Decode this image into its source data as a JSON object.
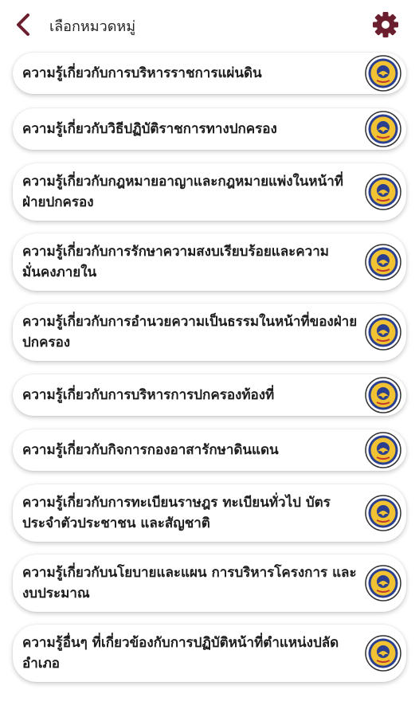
{
  "header": {
    "title": "เลือกหมวดหมู่",
    "back_icon": "chevron-left-icon",
    "settings_icon": "gear-icon",
    "accent_color": "#6b1f2e"
  },
  "categories": [
    {
      "label": "ความรู้เกี่ยวกับการบริหารราชการแผ่นดิน",
      "icon": "dopa-emblem-icon"
    },
    {
      "label": "ความรู้เกี่ยวกับวิธีปฏิบัติราชการทางปกครอง",
      "icon": "dopa-emblem-icon"
    },
    {
      "label": "ความรู้เกี่ยวกับกฎหมายอาญาและกฎหมายแพ่งในหน้าที่ฝ่ายปกครอง",
      "icon": "dopa-emblem-icon"
    },
    {
      "label": "ความรู้เกี่ยวกับการรักษาความสงบเรียบร้อยและความมั่นคงภายใน",
      "icon": "dopa-emblem-icon"
    },
    {
      "label": "ความรู้เกี่ยวกับการอำนวยความเป็นธรรมในหน้าที่ของฝ่ายปกครอง",
      "icon": "dopa-emblem-icon"
    },
    {
      "label": "ความรู้เกี่ยวกับการบริหารการปกครองท้องที่",
      "icon": "dopa-emblem-icon"
    },
    {
      "label": "ความรู้เกี่ยวกับกิจการกองอาสารักษาดินแดน",
      "icon": "dopa-emblem-icon"
    },
    {
      "label": "ความรู้เกี่ยวกับการทะเบียนราษฎร ทะเบียนทั่วไป บัตรประจำตัวประชาชน และสัญชาติ",
      "icon": "dopa-emblem-icon"
    },
    {
      "label": "ความรู้เกี่ยวกับนโยบายและแผน การบริหารโครงการ และงบประมาณ",
      "icon": "dopa-emblem-icon"
    },
    {
      "label": "ความรู้อื่นๆ ที่เกี่ยวข้องกับการปฏิบัติหน้าที่ตำแหน่งปลัดอำเภอ",
      "icon": "dopa-emblem-icon"
    }
  ]
}
